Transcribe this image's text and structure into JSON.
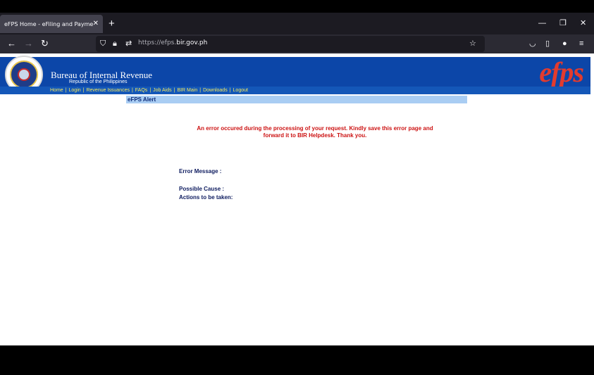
{
  "browser": {
    "tab_title": "eFPS Home - eFiling and Payment S",
    "tab_close": "✕",
    "new_tab": "+",
    "url_scheme": "https://efps.",
    "url_domain": "bir.gov.ph"
  },
  "site": {
    "org_name": "Bureau of Internal Revenue",
    "org_sub": "Republic of the Philippines",
    "logo_text": "efps",
    "menu": [
      "Home",
      "Login",
      "Revenue Issuances",
      "FAQs",
      "Job Aids",
      "BIR Main",
      "Downloads",
      "Logout"
    ],
    "menu_separator": "|"
  },
  "alert": {
    "title": "eFPS Alert",
    "message_line1": "An error occured during the processing of your request. Kindly save this error page and",
    "message_line2": "forward it to BIR Helpdesk. Thank you.",
    "error_message_label": "Error Message :",
    "possible_cause_label": "Possible Cause :",
    "actions_label": "Actions to be taken:"
  }
}
